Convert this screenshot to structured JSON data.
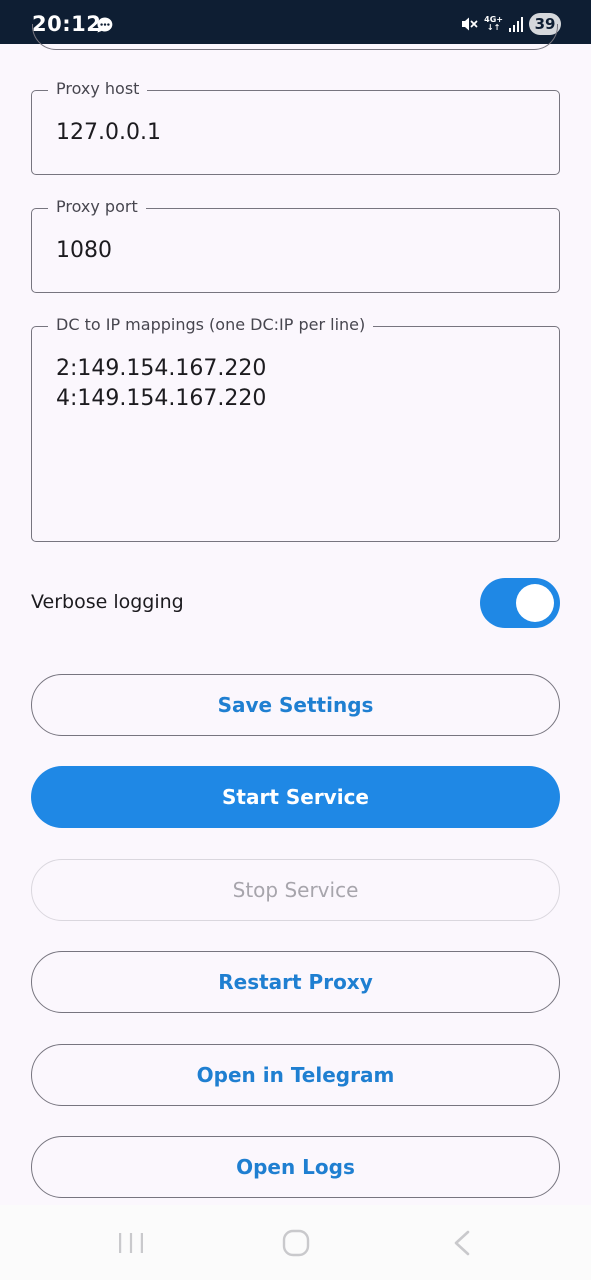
{
  "status_bar": {
    "time": "20:12",
    "network": "4G+",
    "battery": "39",
    "icons": [
      "message-icon",
      "mute-icon",
      "network-icon",
      "signal-icon"
    ]
  },
  "fields": {
    "proxy_host": {
      "label": "Proxy host",
      "value": "127.0.0.1"
    },
    "proxy_port": {
      "label": "Proxy port",
      "value": "1080"
    },
    "dc_mappings": {
      "label": "DC to IP mappings (one DC:IP per line)",
      "lines": [
        "2:149.154.167.220",
        "4:149.154.167.220"
      ]
    }
  },
  "verbose": {
    "label": "Verbose logging",
    "enabled": true
  },
  "buttons": {
    "save": "Save Settings",
    "start": "Start Service",
    "stop": "Stop Service",
    "restart": "Restart Proxy",
    "telegram": "Open in Telegram",
    "logs": "Open Logs"
  },
  "nav_bar": {
    "icons": [
      "recent-apps-icon",
      "home-icon",
      "back-icon"
    ]
  },
  "colors": {
    "accent": "#1f88e5",
    "accent_text": "#1f7fd1",
    "background": "#fbf7fd",
    "outline": "#77757f",
    "status_bar": "#0e1e33"
  }
}
